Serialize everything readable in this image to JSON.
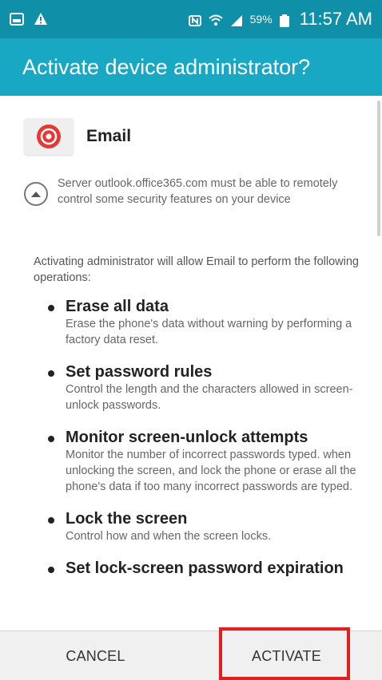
{
  "status_bar": {
    "signal_info": "59%",
    "time": "11:57 AM",
    "left_icons": [
      "gallery-icon",
      "warning-icon"
    ],
    "right_icons": [
      "nfc-icon",
      "wifi-icon",
      "cell-signal-icon",
      "battery-icon"
    ]
  },
  "dialog": {
    "title": "Activate device administrator?",
    "app": {
      "name": "Email",
      "icon": "email-app-icon"
    },
    "server_note": "Server outlook.office365.com must be able to remotely control some security features on your device",
    "intro": "Activating administrator will allow Email to perform the following operations:",
    "permissions": [
      {
        "title": "Erase all data",
        "desc": "Erase the phone's data without warning by performing a factory data reset."
      },
      {
        "title": "Set password rules",
        "desc": "Control the length and the characters allowed in screen-unlock passwords."
      },
      {
        "title": "Monitor screen-unlock attempts",
        "desc": "Monitor the number of incorrect passwords typed. when unlocking the screen, and lock the phone or erase all the phone's data if too many incorrect passwords are typed."
      },
      {
        "title": "Lock the screen",
        "desc": "Control how and when the screen locks."
      },
      {
        "title": "Set lock-screen password expiration",
        "desc": ""
      }
    ],
    "buttons": {
      "cancel": "CANCEL",
      "activate": "ACTIVATE"
    }
  },
  "colors": {
    "status_bar": "#0f8fa8",
    "title_bar": "#19a8c4",
    "highlight": "#e02020",
    "app_icon_red": "#e53935"
  }
}
